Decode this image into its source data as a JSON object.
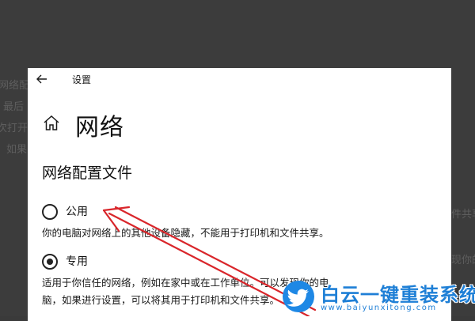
{
  "background": {
    "fragments": [
      "网络配",
      "最后",
      "次打开",
      "如果",
      "件共享",
      "现你的"
    ]
  },
  "window": {
    "title": "设置"
  },
  "header": {
    "title": "网络"
  },
  "network_profile": {
    "section_title": "网络配置文件",
    "options": [
      {
        "label": "公用",
        "selected": false,
        "description_lines": [
          "你的电脑对网络上的其他设备隐藏，不能用于打印机和文件共享。"
        ]
      },
      {
        "label": "专用",
        "selected": true,
        "description_lines": [
          "适用于你信任的网络，例如在家中或在工作单位。可以发现你的电",
          "脑，如果进行设置，可以将其用于打印机和文件共享。"
        ]
      }
    ]
  },
  "watermark": {
    "brand": "白云一键重装系统",
    "url": "www.baiyunxitong.com"
  },
  "colors": {
    "annotation": "#d9262b",
    "watermark": "#1e7fd6",
    "overlay": "#3c3c3c"
  },
  "icons": [
    "back-arrow-icon",
    "home-icon",
    "twitter-bird-icon"
  ]
}
